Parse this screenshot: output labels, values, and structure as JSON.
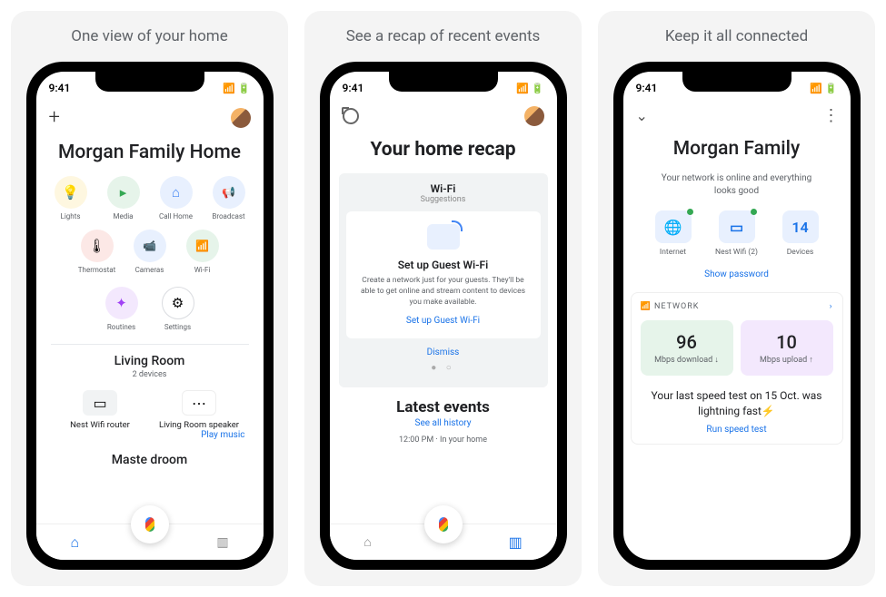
{
  "taglines": [
    "One view of your home",
    "See a recap of recent events",
    "Keep it all connected"
  ],
  "statusbar": {
    "time": "9:41"
  },
  "s1": {
    "title": "Morgan Family Home",
    "icons_r1": [
      {
        "label": "Lights",
        "bg": "#fef7e0",
        "glyph": "💡"
      },
      {
        "label": "Media",
        "bg": "#e6f4ea",
        "glyph": "▸"
      },
      {
        "label": "Call Home",
        "bg": "#e8f0fe",
        "glyph": "⌂"
      },
      {
        "label": "Broadcast",
        "bg": "#e8f0fe",
        "glyph": "📢"
      }
    ],
    "icons_r2": [
      {
        "label": "Thermostat",
        "bg": "#fce8e6",
        "glyph": "🌡"
      },
      {
        "label": "Cameras",
        "bg": "#e8f0fe",
        "glyph": "📹"
      },
      {
        "label": "Wi-Fi",
        "bg": "#e6f4ea",
        "glyph": "📶"
      }
    ],
    "icons_r3": [
      {
        "label": "Routines",
        "bg": "#f3e8fd",
        "glyph": "✦"
      },
      {
        "label": "Settings",
        "bg": "#fff",
        "glyph": "⚙"
      }
    ],
    "room": {
      "name": "Living Room",
      "sub": "2 devices"
    },
    "devices": [
      {
        "name": "Nest Wifi router"
      },
      {
        "name": "Living Room speaker"
      }
    ],
    "play_music": "Play music",
    "room2": "Maste       droom"
  },
  "s2": {
    "title": "Your home recap",
    "box_title": "Wi-Fi",
    "box_sub": "Suggestions",
    "card_h": "Set up Guest Wi-Fi",
    "card_p": "Create a network just for your guests. They'll be able to get online and stream content to devices you make available.",
    "card_link": "Set up Guest Wi-Fi",
    "dismiss": "Dismiss",
    "latest": "Latest events",
    "see_all": "See all history",
    "event": "12:00 PM · In your home"
  },
  "s3": {
    "title": "Morgan Family",
    "sub": "Your network is online and everything looks good",
    "items": [
      {
        "label": "Internet",
        "glyph": "🌐"
      },
      {
        "label": "Nest Wifi (2)",
        "glyph": "▭"
      },
      {
        "label": "Devices",
        "glyph": "14"
      }
    ],
    "show_pw": "Show password",
    "net_label": "NETWORK",
    "dl": {
      "n": "96",
      "l": "Mbps download ↓"
    },
    "ul": {
      "n": "10",
      "l": "Mbps upload ↑"
    },
    "msg": "Your last speed test on 15 Oct. was lightning fast⚡",
    "run": "Run speed test"
  }
}
